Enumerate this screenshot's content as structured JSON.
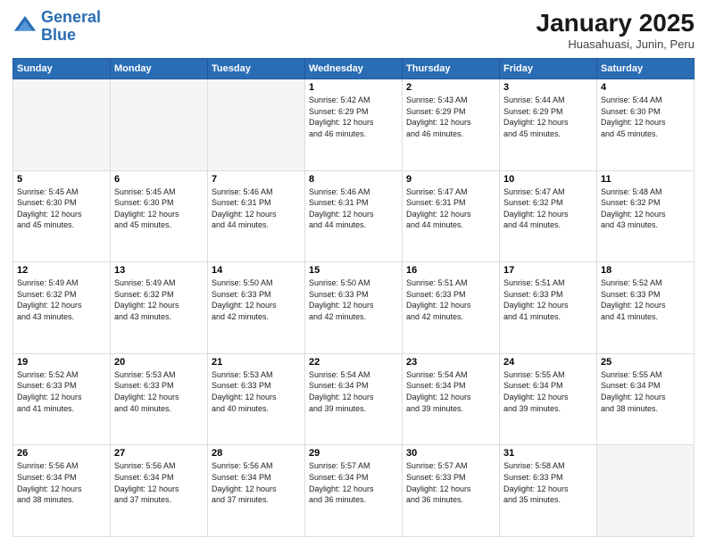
{
  "header": {
    "logo_line1": "General",
    "logo_line2": "Blue",
    "title": "January 2025",
    "subtitle": "Huasahuasi, Junin, Peru"
  },
  "weekdays": [
    "Sunday",
    "Monday",
    "Tuesday",
    "Wednesday",
    "Thursday",
    "Friday",
    "Saturday"
  ],
  "weeks": [
    [
      {
        "day": "",
        "info": ""
      },
      {
        "day": "",
        "info": ""
      },
      {
        "day": "",
        "info": ""
      },
      {
        "day": "1",
        "info": "Sunrise: 5:42 AM\nSunset: 6:29 PM\nDaylight: 12 hours\nand 46 minutes."
      },
      {
        "day": "2",
        "info": "Sunrise: 5:43 AM\nSunset: 6:29 PM\nDaylight: 12 hours\nand 46 minutes."
      },
      {
        "day": "3",
        "info": "Sunrise: 5:44 AM\nSunset: 6:29 PM\nDaylight: 12 hours\nand 45 minutes."
      },
      {
        "day": "4",
        "info": "Sunrise: 5:44 AM\nSunset: 6:30 PM\nDaylight: 12 hours\nand 45 minutes."
      }
    ],
    [
      {
        "day": "5",
        "info": "Sunrise: 5:45 AM\nSunset: 6:30 PM\nDaylight: 12 hours\nand 45 minutes."
      },
      {
        "day": "6",
        "info": "Sunrise: 5:45 AM\nSunset: 6:30 PM\nDaylight: 12 hours\nand 45 minutes."
      },
      {
        "day": "7",
        "info": "Sunrise: 5:46 AM\nSunset: 6:31 PM\nDaylight: 12 hours\nand 44 minutes."
      },
      {
        "day": "8",
        "info": "Sunrise: 5:46 AM\nSunset: 6:31 PM\nDaylight: 12 hours\nand 44 minutes."
      },
      {
        "day": "9",
        "info": "Sunrise: 5:47 AM\nSunset: 6:31 PM\nDaylight: 12 hours\nand 44 minutes."
      },
      {
        "day": "10",
        "info": "Sunrise: 5:47 AM\nSunset: 6:32 PM\nDaylight: 12 hours\nand 44 minutes."
      },
      {
        "day": "11",
        "info": "Sunrise: 5:48 AM\nSunset: 6:32 PM\nDaylight: 12 hours\nand 43 minutes."
      }
    ],
    [
      {
        "day": "12",
        "info": "Sunrise: 5:49 AM\nSunset: 6:32 PM\nDaylight: 12 hours\nand 43 minutes."
      },
      {
        "day": "13",
        "info": "Sunrise: 5:49 AM\nSunset: 6:32 PM\nDaylight: 12 hours\nand 43 minutes."
      },
      {
        "day": "14",
        "info": "Sunrise: 5:50 AM\nSunset: 6:33 PM\nDaylight: 12 hours\nand 42 minutes."
      },
      {
        "day": "15",
        "info": "Sunrise: 5:50 AM\nSunset: 6:33 PM\nDaylight: 12 hours\nand 42 minutes."
      },
      {
        "day": "16",
        "info": "Sunrise: 5:51 AM\nSunset: 6:33 PM\nDaylight: 12 hours\nand 42 minutes."
      },
      {
        "day": "17",
        "info": "Sunrise: 5:51 AM\nSunset: 6:33 PM\nDaylight: 12 hours\nand 41 minutes."
      },
      {
        "day": "18",
        "info": "Sunrise: 5:52 AM\nSunset: 6:33 PM\nDaylight: 12 hours\nand 41 minutes."
      }
    ],
    [
      {
        "day": "19",
        "info": "Sunrise: 5:52 AM\nSunset: 6:33 PM\nDaylight: 12 hours\nand 41 minutes."
      },
      {
        "day": "20",
        "info": "Sunrise: 5:53 AM\nSunset: 6:33 PM\nDaylight: 12 hours\nand 40 minutes."
      },
      {
        "day": "21",
        "info": "Sunrise: 5:53 AM\nSunset: 6:33 PM\nDaylight: 12 hours\nand 40 minutes."
      },
      {
        "day": "22",
        "info": "Sunrise: 5:54 AM\nSunset: 6:34 PM\nDaylight: 12 hours\nand 39 minutes."
      },
      {
        "day": "23",
        "info": "Sunrise: 5:54 AM\nSunset: 6:34 PM\nDaylight: 12 hours\nand 39 minutes."
      },
      {
        "day": "24",
        "info": "Sunrise: 5:55 AM\nSunset: 6:34 PM\nDaylight: 12 hours\nand 39 minutes."
      },
      {
        "day": "25",
        "info": "Sunrise: 5:55 AM\nSunset: 6:34 PM\nDaylight: 12 hours\nand 38 minutes."
      }
    ],
    [
      {
        "day": "26",
        "info": "Sunrise: 5:56 AM\nSunset: 6:34 PM\nDaylight: 12 hours\nand 38 minutes."
      },
      {
        "day": "27",
        "info": "Sunrise: 5:56 AM\nSunset: 6:34 PM\nDaylight: 12 hours\nand 37 minutes."
      },
      {
        "day": "28",
        "info": "Sunrise: 5:56 AM\nSunset: 6:34 PM\nDaylight: 12 hours\nand 37 minutes."
      },
      {
        "day": "29",
        "info": "Sunrise: 5:57 AM\nSunset: 6:34 PM\nDaylight: 12 hours\nand 36 minutes."
      },
      {
        "day": "30",
        "info": "Sunrise: 5:57 AM\nSunset: 6:33 PM\nDaylight: 12 hours\nand 36 minutes."
      },
      {
        "day": "31",
        "info": "Sunrise: 5:58 AM\nSunset: 6:33 PM\nDaylight: 12 hours\nand 35 minutes."
      },
      {
        "day": "",
        "info": ""
      }
    ]
  ]
}
